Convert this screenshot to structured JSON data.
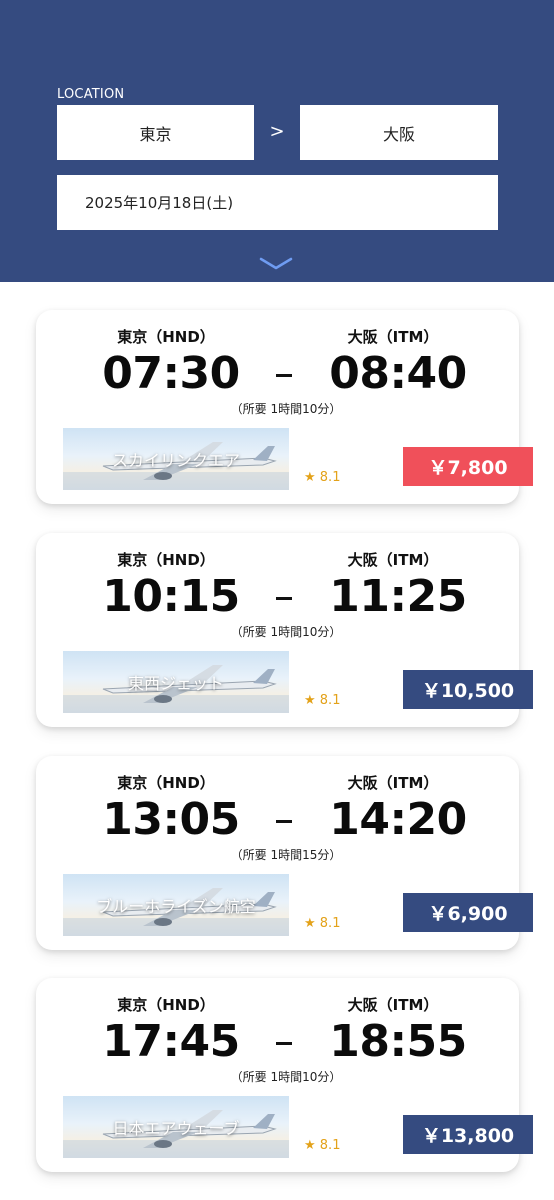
{
  "header": {
    "location_label": "LOCATION",
    "origin": "東京",
    "swap_icon": ">",
    "destination": "大阪",
    "date": "2025年10月18日(土)"
  },
  "colors": {
    "header_bg": "#354b80",
    "price_highlight": "#f0505a",
    "price_standard": "#354b80",
    "rating_star": "#e3a21a",
    "expand_chevron": "#6f9cf2"
  },
  "flights": [
    {
      "dep_airport": "東京（HND）",
      "arr_airport": "大阪（ITM）",
      "dep_time": "07:30",
      "arr_time": "08:40",
      "duration": "（所要 1時間10分）",
      "airline": "スカイリンクエア",
      "rating": "★ 8.1",
      "price": "￥7,800",
      "price_style": "highlight"
    },
    {
      "dep_airport": "東京（HND）",
      "arr_airport": "大阪（ITM）",
      "dep_time": "10:15",
      "arr_time": "11:25",
      "duration": "（所要 1時間10分）",
      "airline": "東西ジェット",
      "rating": "★ 8.1",
      "price": "￥10,500",
      "price_style": "standard"
    },
    {
      "dep_airport": "東京（HND）",
      "arr_airport": "大阪（ITM）",
      "dep_time": "13:05",
      "arr_time": "14:20",
      "duration": "（所要 1時間15分）",
      "airline": "ブルーホライズン航空",
      "rating": "★ 8.1",
      "price": "￥6,900",
      "price_style": "standard"
    },
    {
      "dep_airport": "東京（HND）",
      "arr_airport": "大阪（ITM）",
      "dep_time": "17:45",
      "arr_time": "18:55",
      "duration": "（所要 1時間10分）",
      "airline": "日本エアウェーブ",
      "rating": "★ 8.1",
      "price": "￥13,800",
      "price_style": "standard"
    }
  ]
}
